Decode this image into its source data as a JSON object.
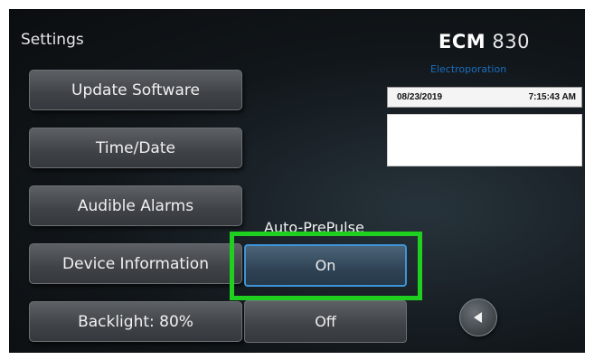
{
  "screen": {
    "title": "Settings"
  },
  "menu": {
    "items": [
      {
        "label": "Update Software"
      },
      {
        "label": "Time/Date"
      },
      {
        "label": "Audible Alarms"
      },
      {
        "label": "Device Information"
      },
      {
        "label": "Backlight: 80%"
      }
    ]
  },
  "brand": {
    "name": "ECM",
    "model": "830",
    "subtitle": "Electroporation",
    "subtitle_color": "#1c6fbf"
  },
  "status": {
    "date": "08/23/2019",
    "time": "7:15:43 AM"
  },
  "prepulse": {
    "label": "Auto-PrePulse",
    "on_label": "On",
    "off_label": "Off",
    "selected": "On",
    "highlight_color": "#20d020"
  },
  "nav": {
    "back_icon": "triangle-left-icon"
  }
}
